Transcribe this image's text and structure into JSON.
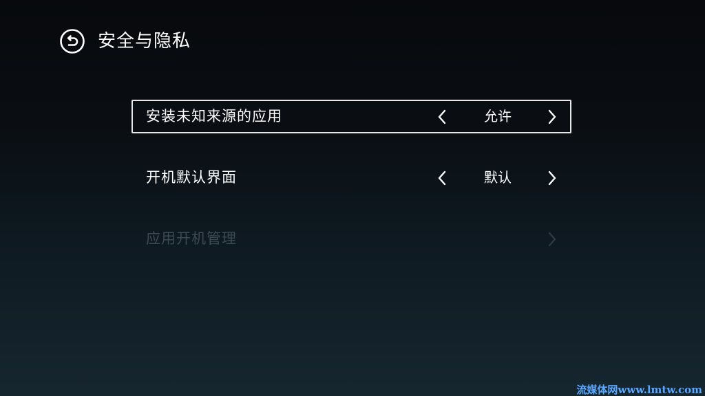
{
  "header": {
    "back_icon": "back-circle-arrow-icon",
    "title": "安全与隐私"
  },
  "settings": [
    {
      "label": "安装未知来源的应用",
      "value": "允许",
      "focused": true,
      "enabled": true
    },
    {
      "label": "开机默认界面",
      "value": "默认",
      "focused": false,
      "enabled": true
    },
    {
      "label": "应用开机管理",
      "value": "",
      "focused": false,
      "enabled": false
    }
  ],
  "watermark": "流媒体网www.lmtw.com",
  "colors": {
    "text": "#ffffff",
    "disabled_text": "#3c4a52",
    "focus_border": "#e8e8e8",
    "watermark": "#5aa7ff"
  }
}
